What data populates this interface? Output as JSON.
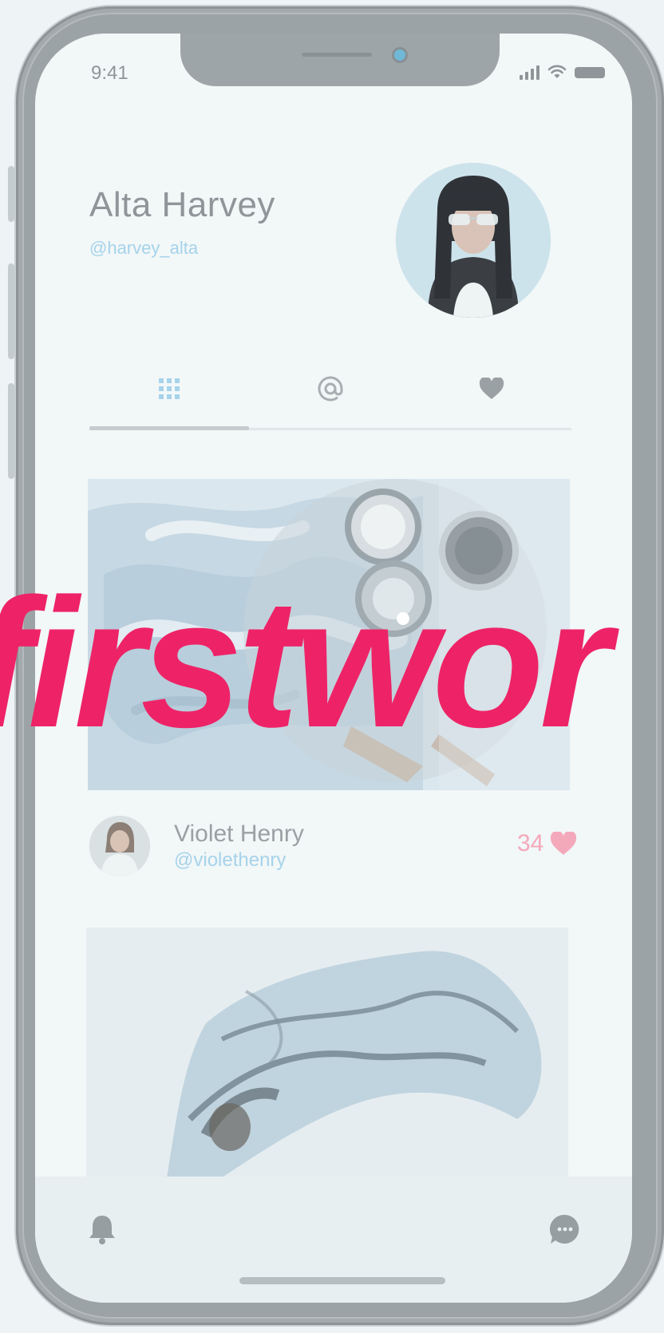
{
  "status_bar": {
    "time": "9:41"
  },
  "profile": {
    "name": "Alta Harvey",
    "handle": "@harvey_alta"
  },
  "tabs": [
    {
      "icon": "grid-icon",
      "active": true
    },
    {
      "icon": "at-icon",
      "active": false
    },
    {
      "icon": "heart-icon",
      "active": false
    }
  ],
  "post": {
    "author_name": "Violet Henry",
    "author_handle": "@violethenry",
    "likes": "34"
  },
  "bottom_nav": {
    "left_icon": "bell-icon",
    "right_icon": "chat-icon"
  },
  "overlay": {
    "text": "firstwor"
  },
  "colors": {
    "accent": "#a6d3ea",
    "like": "#f4a9ba",
    "overlay": "#ee2367"
  }
}
